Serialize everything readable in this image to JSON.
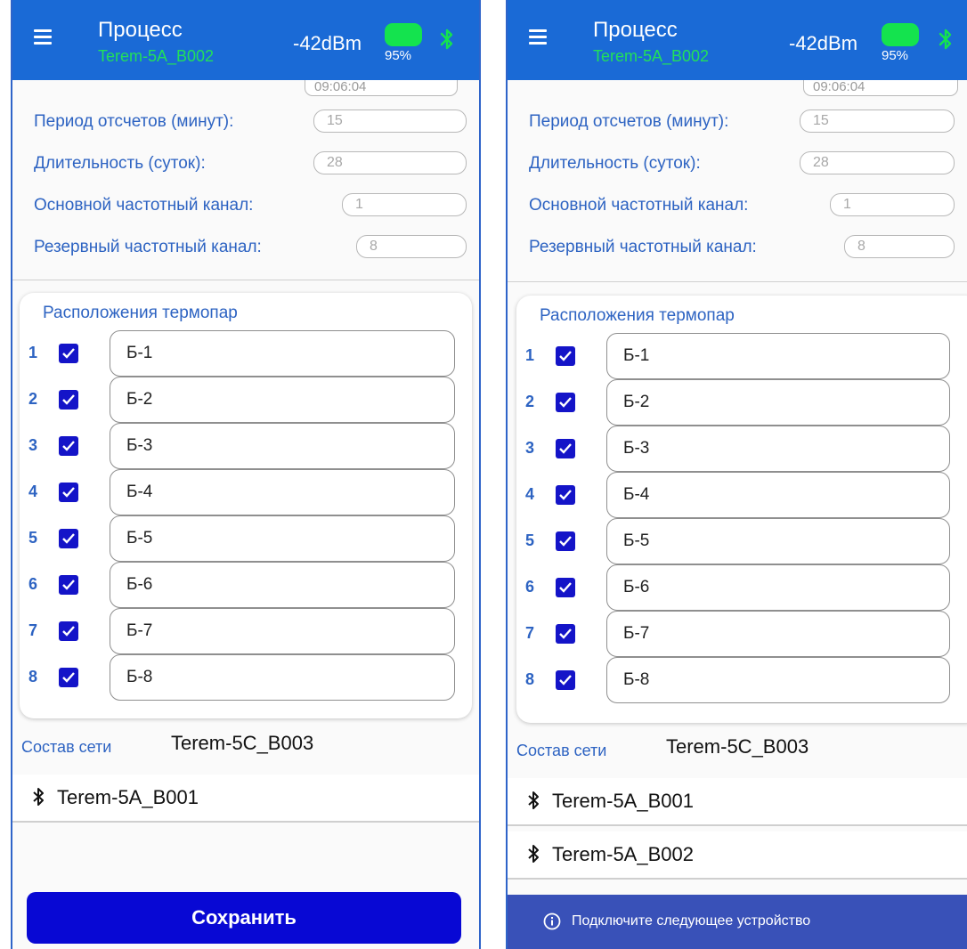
{
  "screens": [
    {
      "appbar": {
        "title": "Процесс",
        "subtitle": "Terem-5A_B002",
        "rssi": "-42dBm",
        "battery": "95%"
      },
      "form": {
        "time_value": "09:06:04",
        "fields": [
          {
            "label": "Период отсчетов (минут):",
            "value": "15"
          },
          {
            "label": "Длительность (суток):",
            "value": "28"
          },
          {
            "label": "Основной частотный канал:",
            "value": "1"
          },
          {
            "label": "Резервный частотный канал:",
            "value": "8"
          }
        ]
      },
      "thermocouples": {
        "title": "Расположения термопар",
        "items": [
          {
            "num": "1",
            "checked": true,
            "name": "Б-1"
          },
          {
            "num": "2",
            "checked": true,
            "name": "Б-2"
          },
          {
            "num": "3",
            "checked": true,
            "name": "Б-3"
          },
          {
            "num": "4",
            "checked": true,
            "name": "Б-4"
          },
          {
            "num": "5",
            "checked": true,
            "name": "Б-5"
          },
          {
            "num": "6",
            "checked": true,
            "name": "Б-6"
          },
          {
            "num": "7",
            "checked": true,
            "name": "Б-7"
          },
          {
            "num": "8",
            "checked": true,
            "name": "Б-8"
          }
        ]
      },
      "network": {
        "label": "Состав сети",
        "value": "Terem-5C_B003",
        "devices": [
          "Terem-5A_B001"
        ]
      },
      "save_label": "Сохранить"
    },
    {
      "appbar": {
        "title": "Процесс",
        "subtitle": "Terem-5A_B002",
        "rssi": "-42dBm",
        "battery": "95%"
      },
      "form": {
        "time_value": "09:06:04",
        "fields": [
          {
            "label": "Период отсчетов (минут):",
            "value": "15"
          },
          {
            "label": "Длительность (суток):",
            "value": "28"
          },
          {
            "label": "Основной частотный канал:",
            "value": "1"
          },
          {
            "label": "Резервный частотный канал:",
            "value": "8"
          }
        ]
      },
      "thermocouples": {
        "title": "Расположения термопар",
        "items": [
          {
            "num": "1",
            "checked": true,
            "name": "Б-1"
          },
          {
            "num": "2",
            "checked": true,
            "name": "Б-2"
          },
          {
            "num": "3",
            "checked": true,
            "name": "Б-3"
          },
          {
            "num": "4",
            "checked": true,
            "name": "Б-4"
          },
          {
            "num": "5",
            "checked": true,
            "name": "Б-5"
          },
          {
            "num": "6",
            "checked": true,
            "name": "Б-6"
          },
          {
            "num": "7",
            "checked": true,
            "name": "Б-7"
          },
          {
            "num": "8",
            "checked": true,
            "name": "Б-8"
          }
        ]
      },
      "network": {
        "label": "Состав сети",
        "value": "Terem-5C_B003",
        "devices": [
          "Terem-5A_B001",
          "Terem-5A_B002"
        ]
      },
      "snackbar": {
        "text": "Подключите следующее устройство"
      }
    }
  ],
  "colors": {
    "appbar": "#1a6ad6",
    "accent_text": "#2d63c2",
    "subtitle_green": "#22e05a",
    "battery": "#14e34e",
    "checkbox": "#1414c8",
    "save_button": "#0808d4",
    "snackbar": "#3951b8"
  },
  "icons": {
    "menu": "hamburger-icon",
    "bluetooth": "bluetooth-icon",
    "battery": "battery-icon",
    "checkbox": "checkbox-checked-icon",
    "info": "info-icon"
  }
}
